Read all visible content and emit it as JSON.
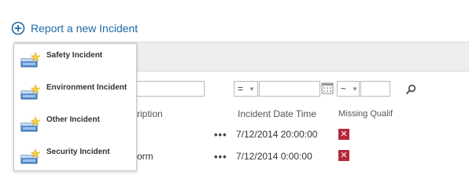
{
  "report_link": {
    "label": "Report a new Incident",
    "icon": "plus-circle-icon"
  },
  "menu": {
    "items": [
      {
        "label": "Safety Incident",
        "icon": "new-item-icon"
      },
      {
        "label": "Environment Incident",
        "icon": "new-item-icon"
      },
      {
        "label": "Other Incident",
        "icon": "new-item-icon"
      },
      {
        "label": "Security Incident",
        "icon": "new-item-icon"
      }
    ]
  },
  "filters": {
    "date_operator": "=",
    "time_operator": "~"
  },
  "columns": {
    "description_partial": "ription",
    "incident_date_time": "Incident Date Time",
    "missing_qualif": "Missing Qualif"
  },
  "rows": [
    {
      "description_partial": "",
      "ellipsis": "•••",
      "date_time": "7/12/2014 20:00:00",
      "missing_qualif_icon": "x-mark-icon"
    },
    {
      "description_partial": "orm",
      "ellipsis": "•••",
      "date_time": "7/12/2014 0:00:00",
      "missing_qualif_icon": "x-mark-icon"
    }
  ],
  "colors": {
    "link": "#1f6aa5",
    "error_badge": "#b5273a",
    "band": "#eeeeee"
  }
}
